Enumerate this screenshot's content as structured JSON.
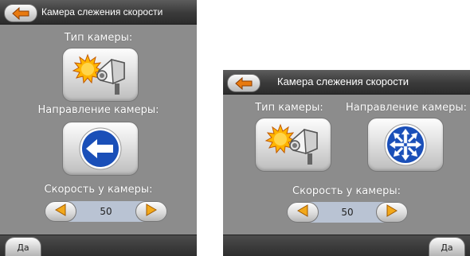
{
  "screens": [
    {
      "title": "Камера слежения скорости",
      "camera_type_label": "Тип камеры:",
      "direction_label": "Направление камеры:",
      "speed_label": "Скорость у камеры:",
      "speed_value": "50",
      "yes_label": "Да",
      "direction_icon": "arrow-left-sign-icon"
    },
    {
      "title": "Камера слежения скорости",
      "camera_type_label": "Тип камеры:",
      "direction_label": "Направление камеры:",
      "speed_label": "Скорость у камеры:",
      "speed_value": "50",
      "yes_label": "Да",
      "direction_icon": "all-directions-sign-icon"
    }
  ],
  "colors": {
    "panel_background": "#8c8c8c",
    "bar_dark": "#2e2e2e",
    "back_arrow": "#e87a10",
    "speed_arrow": "#f2a81a",
    "sign_blue": "#1a4fb8",
    "speed_field": "#b9c3d3"
  }
}
